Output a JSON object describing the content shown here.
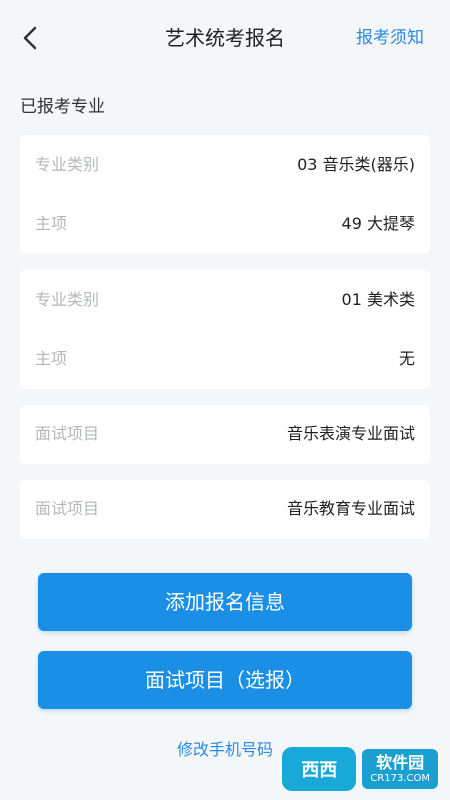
{
  "header": {
    "title": "艺术统考报名",
    "notice_link": "报考须知",
    "back_icon": "chevron-left-icon"
  },
  "section": {
    "title": "已报考专业"
  },
  "cards": [
    {
      "rows": [
        {
          "label": "专业类别",
          "value": "03 音乐类(器乐)"
        },
        {
          "label": "主项",
          "value": "49 大提琴"
        }
      ]
    },
    {
      "rows": [
        {
          "label": "专业类别",
          "value": "01 美术类"
        },
        {
          "label": "主项",
          "value": "无"
        }
      ]
    },
    {
      "rows": [
        {
          "label": "面试项目",
          "value": "音乐表演专业面试"
        }
      ]
    },
    {
      "rows": [
        {
          "label": "面试项目",
          "value": "音乐教育专业面试"
        }
      ]
    }
  ],
  "buttons": {
    "add": "添加报名信息",
    "interview": "面试项目（选报）"
  },
  "links": {
    "change_phone": "修改手机号码"
  },
  "watermark": {
    "logo": "西西",
    "brand": "软件园",
    "site": "CR173.COM"
  },
  "colors": {
    "accent": "#1b8fe6",
    "link": "#2a8ae6",
    "background": "#f4f6f9"
  }
}
